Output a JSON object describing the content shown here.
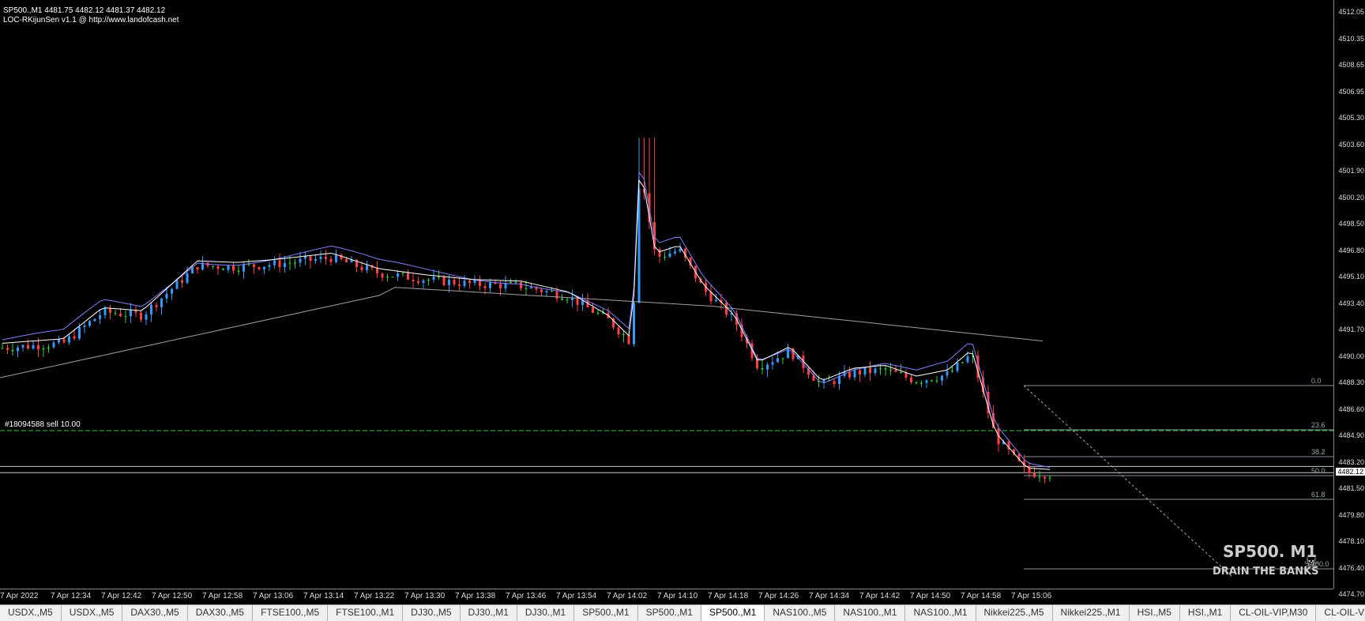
{
  "chart": {
    "header": "SP500.,M1  4481.75 4482.12 4481.37 4482.12",
    "indicator": "LOC-RKijunSen v1.1 @ http://www.landofcash.net",
    "order_label": "#18094588 sell 10.00",
    "current_price": "4482.12",
    "watermark_symbol": "SP500. M1",
    "watermark_slogan": "DRAIN THE BANKS",
    "colors": {
      "bull": "#3399ff",
      "bear": "#ff4040",
      "doji": "#33cc33",
      "kijun": "#ffffff",
      "tenkan": "#8080ff",
      "ma": "#a0a0a0",
      "order_line": "#33cc33",
      "fibo": "#b0c4de"
    }
  },
  "price_axis": [
    "4512.05",
    "4510.35",
    "4508.65",
    "4506.95",
    "4505.30",
    "4503.60",
    "4501.90",
    "4500.20",
    "4498.50",
    "4496.80",
    "4495.10",
    "4493.40",
    "4491.70",
    "4490.00",
    "4488.30",
    "4486.60",
    "4484.90",
    "4483.20",
    "4481.50",
    "4479.80",
    "4478.10",
    "4476.40",
    "4474.70"
  ],
  "time_axis": [
    "7 Apr 2022",
    "7 Apr 12:34",
    "7 Apr 12:42",
    "7 Apr 12:50",
    "7 Apr 12:58",
    "7 Apr 13:06",
    "7 Apr 13:14",
    "7 Apr 13:22",
    "7 Apr 13:30",
    "7 Apr 13:38",
    "7 Apr 13:46",
    "7 Apr 13:54",
    "7 Apr 14:02",
    "7 Apr 14:10",
    "7 Apr 14:18",
    "7 Apr 14:26",
    "7 Apr 14:34",
    "7 Apr 14:42",
    "7 Apr 14:50",
    "7 Apr 14:58",
    "7 Apr 15:06"
  ],
  "fibo_levels": [
    "0.0",
    "23.6",
    "38.2",
    "50.0",
    "61.8",
    "100.0"
  ],
  "tabs": [
    "USDX.,M5",
    "USDX.,M5",
    "DAX30.,M5",
    "DAX30.,M5",
    "FTSE100.,M5",
    "FTSE100.,M1",
    "DJ30.,M5",
    "DJ30.,M1",
    "DJ30.,M1",
    "SP500.,M1",
    "SP500.,M1",
    "SP500.,M1",
    "NAS100.,M5",
    "NAS100.,M1",
    "NAS100.,M1",
    "Nikkei225.,M5",
    "Nikkei225.,M1",
    "HSI.,M5",
    "HSI.,M1",
    "CL-OIL-VIP,M30",
    "CL-OIL-VIP,M..."
  ],
  "active_tab": 11
}
